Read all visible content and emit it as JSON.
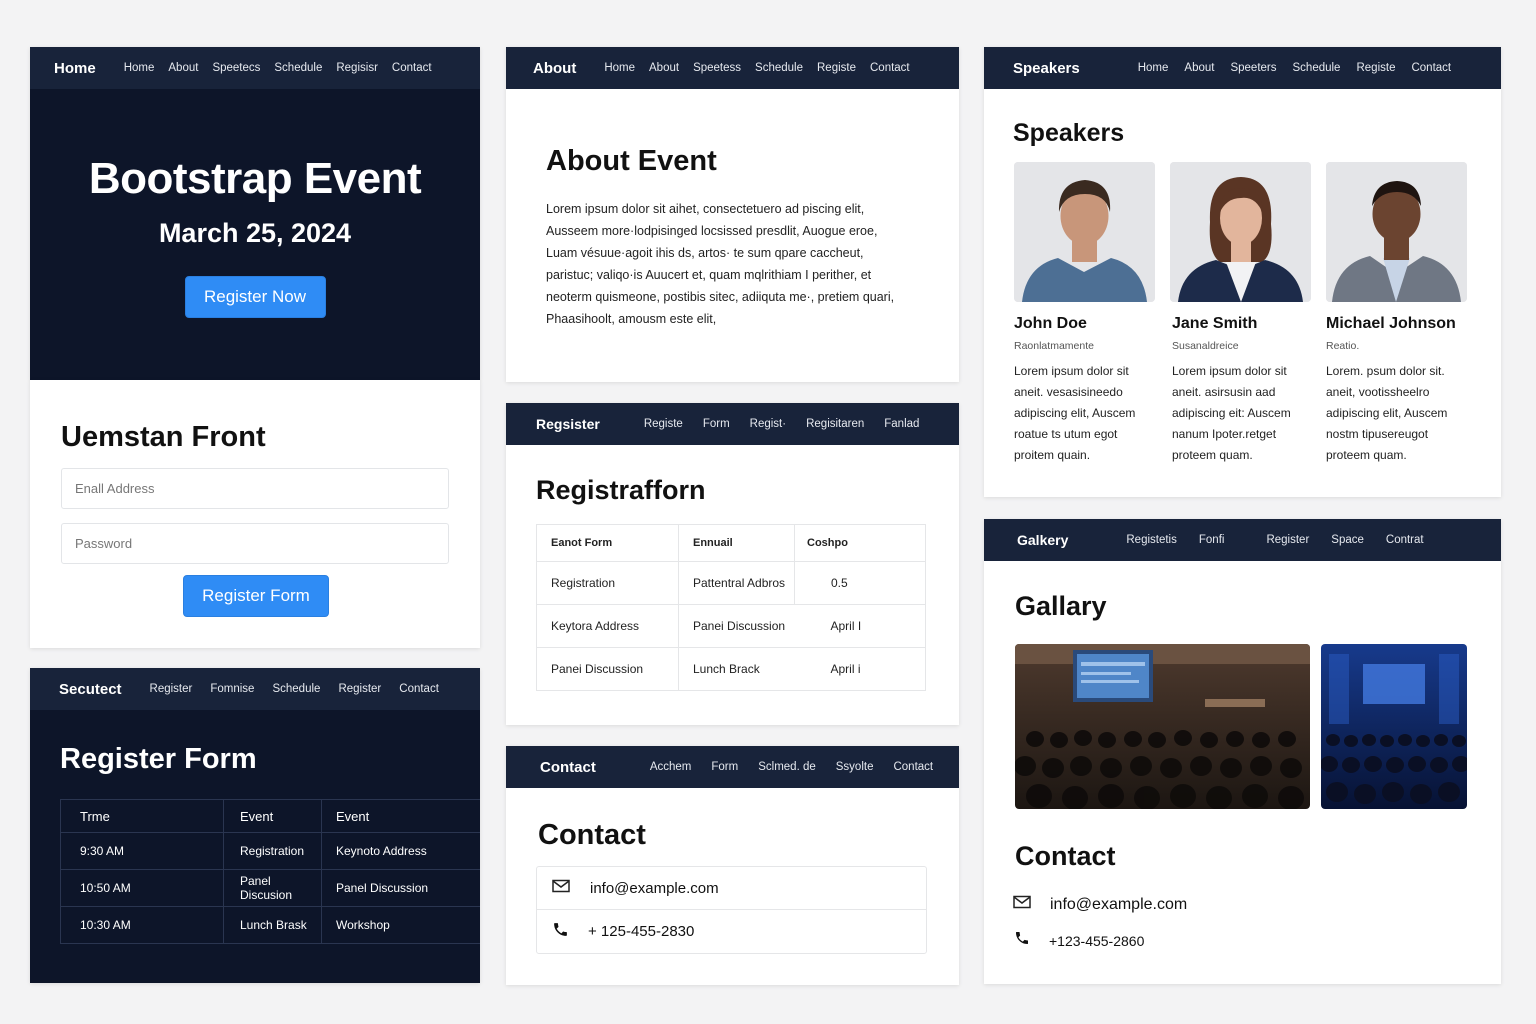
{
  "hero": {
    "nav_brand": "Home",
    "nav_links": [
      "Home",
      "About",
      "Speetecs",
      "Schedule",
      "Regisisr",
      "Contact"
    ],
    "title": "Bootstrap Event",
    "date": "March 25, 2024",
    "cta": "Register Now"
  },
  "login": {
    "title": "Uemstan Front",
    "email_placeholder": "Enall Address",
    "password_placeholder": "Password",
    "button": "Register Form"
  },
  "schedule": {
    "nav_brand": "Secutect",
    "nav_links": [
      "Register",
      "Fomnise",
      "Schedule",
      "Register",
      "Contact"
    ],
    "title": "Register Form",
    "headers": [
      "Trme",
      "Event",
      "Event"
    ],
    "rows": [
      [
        "9:30 AM",
        "Registration",
        "Keynoto Address"
      ],
      [
        "10:50 AM",
        "Panel Discusion",
        "Panel Discussion"
      ],
      [
        "10:30 AM",
        "Lunch Brask",
        "Workshop"
      ]
    ]
  },
  "about": {
    "nav_brand": "About",
    "nav_links": [
      "Home",
      "About",
      "Speetess",
      "Schedule",
      "Registe",
      "Contact"
    ],
    "title": "About Event",
    "lines": [
      "Lorem ipsum dolor sit aihet, consectetuero ad piscing elit,",
      "Ausseem more·lodpisinged locsissed presdlit, Auogue eroe,",
      "Luam vésuue·agoit ihis ds, artos· te sum qpare caccheut,",
      "paristuc; valiqo·is Auucert et, quam mqlrithiam I perither, et",
      "neoterm quismeone, postibis sitec, adiiquta me·, pretiem quari,",
      "Phaasihoolt, amousm este elit,"
    ]
  },
  "registration": {
    "nav_brand": "Regsister",
    "nav_links": [
      "Registe",
      "Form",
      "Regist·",
      "Regisitaren",
      "Fanlad"
    ],
    "title": "Registrafforn",
    "headers": [
      "Eanot Form",
      "Ennuail",
      "Coshpo"
    ],
    "rows": [
      [
        "Registration",
        "Pattentral Adbros",
        "0.5"
      ],
      [
        "Keytora Address",
        "Panei Discussion",
        "April I"
      ],
      [
        "Panei Discussion",
        "Lunch Brack",
        "April i"
      ]
    ]
  },
  "contact_mid": {
    "nav_brand": "Contact",
    "nav_links": [
      "Acchem",
      "Form",
      "Sclmed. de",
      "Ssyolte",
      "Contact"
    ],
    "title": "Contact",
    "email": "info@example.com",
    "phone": "+ 125-455-2830"
  },
  "speakers": {
    "nav_brand": "Speakers",
    "nav_links": [
      "Home",
      "About",
      "Speeters",
      "Schedule",
      "Registe",
      "Contact"
    ],
    "title": "Speakers",
    "items": [
      {
        "name": "John Doe",
        "role": "Raonlatmamente",
        "bio": [
          "Lorem ipsum dolor sit",
          "aneit. vesasisineedo",
          "adipiscing elit, Auscem",
          "roatue ts utum egot",
          "proitem quain."
        ],
        "shirt": "#4d6f94",
        "skin": "#c8967a",
        "hair": "#3a2a20"
      },
      {
        "name": "Jane Smith",
        "role": "Susanaldreice",
        "bio": [
          "Lorem ipsum dolor sit",
          "aneit. asirsusin aad",
          "adipiscing eit: Auscem",
          "nanum Ipoter.retget",
          "proteem quam."
        ],
        "shirt": "#1d2b4a",
        "skin": "#e2b59c",
        "hair": "#5a3524"
      },
      {
        "name": "Michael Johnson",
        "role": "Reatio.",
        "bio": [
          "Lorem. psum dolor sit.",
          "aneit, vootissheelro",
          "adipiscing elit, Auscem",
          "nostm tipusereugot",
          "proteem quam."
        ],
        "shirt": "#6f7784",
        "skin": "#6b4430",
        "hair": "#1e1410"
      }
    ]
  },
  "gallery": {
    "nav_brand": "Galkery",
    "nav_links": [
      "Registetis",
      "Fonfi",
      "Register",
      "Space",
      "Contrat"
    ],
    "title": "Gallary",
    "contact_title": "Contact",
    "email": "info@example.com",
    "phone": "+123-455-2860"
  },
  "colors": {
    "nav": "#18233a",
    "dark_panel": "#0d1529",
    "accent": "#2f8cf5"
  },
  "icons": [
    "envelope-icon",
    "phone-icon"
  ]
}
